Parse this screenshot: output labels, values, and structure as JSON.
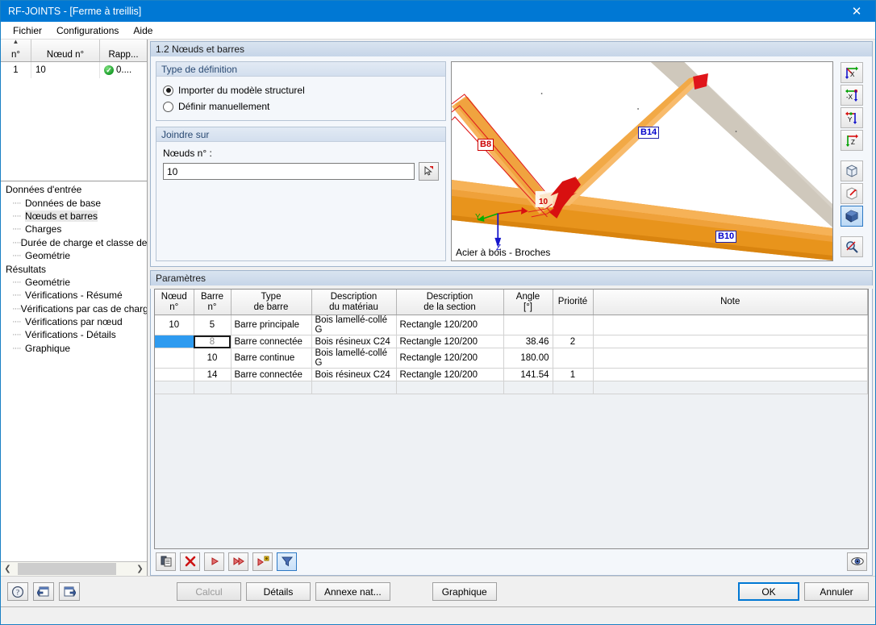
{
  "window": {
    "title": "RF-JOINTS - [Ferme à treillis]",
    "close_icon": "close-icon"
  },
  "menu": {
    "items": [
      "Fichier",
      "Configurations",
      "Aide"
    ]
  },
  "node_grid": {
    "columns": [
      "n°",
      "Nœud n°",
      "Rapp..."
    ],
    "rows": [
      {
        "index": "1",
        "node": "10",
        "status_icon": "check-circle-icon",
        "ratio": "0...."
      }
    ]
  },
  "tree": {
    "groups": [
      {
        "label": "Données d'entrée",
        "items": [
          {
            "label": "Données de base",
            "selected": false
          },
          {
            "label": "Nœuds et barres",
            "selected": true
          },
          {
            "label": "Charges",
            "selected": false
          },
          {
            "label": "Durée de charge et classe de s",
            "selected": false
          },
          {
            "label": "Geométrie",
            "selected": false
          }
        ]
      },
      {
        "label": "Résultats",
        "items": [
          {
            "label": "Geométrie",
            "selected": false
          },
          {
            "label": "Vérifications - Résumé",
            "selected": false
          },
          {
            "label": "Vérifications par cas de charge",
            "selected": false
          },
          {
            "label": "Vérifications par nœud",
            "selected": false
          },
          {
            "label": "Vérifications - Détails",
            "selected": false
          },
          {
            "label": "Graphique",
            "selected": false
          }
        ]
      }
    ]
  },
  "section": {
    "title": "1.2 Nœuds et barres"
  },
  "definition_group": {
    "title": "Type de définition",
    "options": [
      {
        "label": "Importer du modèle structurel",
        "selected": true
      },
      {
        "label": "Définir manuellement",
        "selected": false
      }
    ]
  },
  "joindre_group": {
    "title": "Joindre sur",
    "field_label": "Nœuds n° :",
    "field_value": "10",
    "field_placeholder": "",
    "pick_icon": "pick-node-icon"
  },
  "viewport": {
    "caption": "Acier à bois - Broches",
    "member_labels": [
      {
        "text": "B8",
        "color": "#cc0000"
      },
      {
        "text": "B14",
        "color": "#0000cc"
      },
      {
        "text": "B10",
        "color": "#0000cc"
      }
    ],
    "node_label": "10",
    "axes": [
      {
        "text": "Y",
        "color": "#00aa00"
      },
      {
        "text": "Z",
        "color": "#0000cc"
      }
    ],
    "tools": [
      {
        "name": "view-x-icon",
        "label": "X",
        "active": false
      },
      {
        "name": "view-minus-x-icon",
        "label": "-X",
        "active": false
      },
      {
        "name": "view-y-icon",
        "label": "Y",
        "active": false
      },
      {
        "name": "view-z-icon",
        "label": "Z",
        "active": false
      },
      {
        "name": "view-isometric-icon",
        "label": "",
        "active": false
      },
      {
        "name": "view-rotate-icon",
        "label": "",
        "active": false
      },
      {
        "name": "view-render-icon",
        "label": "",
        "active": true
      },
      {
        "name": "zoom-icon",
        "label": "",
        "active": false
      }
    ]
  },
  "params": {
    "title": "Paramètres",
    "columns": [
      {
        "l1": "Nœud",
        "l2": "n°"
      },
      {
        "l1": "Barre",
        "l2": "n°"
      },
      {
        "l1": "Type",
        "l2": "de barre"
      },
      {
        "l1": "Description",
        "l2": "du matériau"
      },
      {
        "l1": "Description",
        "l2": "de la section"
      },
      {
        "l1": "Angle",
        "l2": "[°]"
      },
      {
        "l1": "Priorité",
        "l2": ""
      },
      {
        "l1": "Note",
        "l2": ""
      }
    ],
    "rows": [
      {
        "node": "10",
        "bar": "5",
        "type": "Barre principale",
        "material": "Bois lamellé-collé G",
        "section": "Rectangle 120/200",
        "angle": "",
        "priority": "",
        "note": "",
        "node_selected": false,
        "bar_selected": false
      },
      {
        "node": "",
        "bar": "8",
        "type": "Barre connectée",
        "material": "Bois résineux C24",
        "section": "Rectangle 120/200",
        "angle": "38.46",
        "priority": "2",
        "note": "",
        "node_selected": true,
        "bar_selected": true
      },
      {
        "node": "",
        "bar": "10",
        "type": "Barre continue",
        "material": "Bois lamellé-collé G",
        "section": "Rectangle 120/200",
        "angle": "180.00",
        "priority": "",
        "note": "",
        "node_selected": false,
        "bar_selected": false
      },
      {
        "node": "",
        "bar": "14",
        "type": "Barre connectée",
        "material": "Bois résineux C24",
        "section": "Rectangle 120/200",
        "angle": "141.54",
        "priority": "1",
        "note": "",
        "node_selected": false,
        "bar_selected": false
      }
    ],
    "toolbar": [
      {
        "name": "copy-icon",
        "active": false
      },
      {
        "name": "delete-icon",
        "active": false
      },
      {
        "name": "next-icon",
        "active": false
      },
      {
        "name": "fast-forward-icon",
        "active": false
      },
      {
        "name": "add-row-icon",
        "active": false
      },
      {
        "name": "filter-icon",
        "active": true
      }
    ],
    "visibility_icon": "eye-icon"
  },
  "footer": {
    "help_icon": "help-icon",
    "prev_icon": "previous-page-icon",
    "next_icon": "next-page-icon",
    "calcul_label": "Calcul",
    "details_label": "Détails",
    "annexe_label": "Annexe nat...",
    "graphique_label": "Graphique",
    "ok_label": "OK",
    "cancel_label": "Annuler"
  },
  "colors": {
    "title_bar": "#0078d4",
    "accent": "#0078d4",
    "selection": "#2e9bf0",
    "group_header": "#2a4a73",
    "timber_light": "#f5b15a",
    "timber_dark": "#e08e1e",
    "load_arrow": "#d81010",
    "member_label_blue": "#0000cc",
    "member_label_red": "#cc0000"
  }
}
